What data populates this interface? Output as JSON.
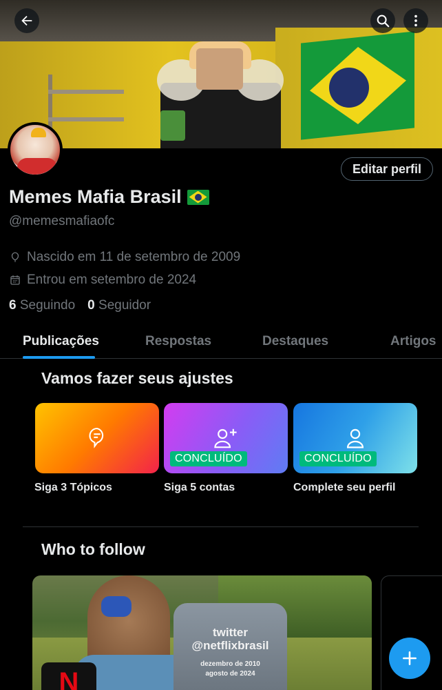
{
  "header": {
    "back_icon": "arrow-left-icon",
    "search_icon": "search-icon",
    "more_icon": "more-vertical-icon"
  },
  "profile": {
    "name": "Memes Mafia Brasil",
    "flag_icon": "brazil-flag-icon",
    "handle": "@memesmafiaofc",
    "edit_label": "Editar perfil",
    "birth": "Nascido em 11 de setembro de 2009",
    "joined": "Entrou em setembro de 2024",
    "following_count": "6",
    "following_label": "Seguindo",
    "followers_count": "0",
    "followers_label": "Seguidor"
  },
  "tabs": [
    {
      "label": "Publicações",
      "active": true
    },
    {
      "label": "Respostas",
      "active": false
    },
    {
      "label": "Destaques",
      "active": false
    },
    {
      "label": "Artigos",
      "active": false
    }
  ],
  "setup": {
    "title": "Vamos fazer seus ajustes",
    "cards": [
      {
        "label": "Siga 3 Tópicos",
        "badge": "",
        "icon": "topic-bubble-icon"
      },
      {
        "label": "Siga 5 contas",
        "badge": "CONCLUÍDO",
        "icon": "person-add-icon"
      },
      {
        "label": "Complete seu perfil",
        "badge": "CONCLUÍDO",
        "icon": "person-icon"
      }
    ]
  },
  "who_to_follow": {
    "title": "Who to follow",
    "tombstone_line1": "twitter",
    "tombstone_line2": "@netflixbrasil",
    "tombstone_line3": "dezembro de 2010",
    "tombstone_line4": "agosto de 2024",
    "logo_letter": "N"
  },
  "fab": {
    "icon": "plus-icon"
  },
  "colors": {
    "accent": "#1d9bf0",
    "badge": "#00ba7c",
    "muted": "#71767b"
  }
}
